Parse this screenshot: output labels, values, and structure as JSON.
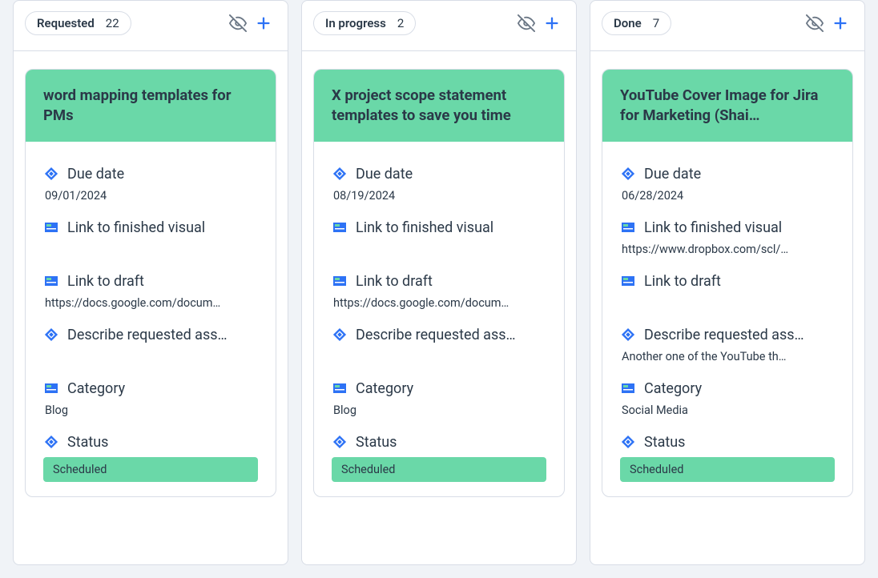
{
  "field_labels": {
    "due_date": "Due date",
    "link_visual": "Link to finished visual",
    "link_draft": "Link to draft",
    "describe": "Describe requested ass…",
    "category": "Category",
    "status": "Status"
  },
  "columns": [
    {
      "name": "Requested",
      "count": "22",
      "card": {
        "title": "word mapping templates for PMs",
        "due_date": "09/01/2024",
        "link_visual": "",
        "link_draft": "https://docs.google.com/docum…",
        "describe": "",
        "category": "Blog",
        "status": "Scheduled"
      }
    },
    {
      "name": "In progress",
      "count": "2",
      "card": {
        "title": "X project scope statement templates to save you time",
        "due_date": "08/19/2024",
        "link_visual": "",
        "link_draft": "https://docs.google.com/docum…",
        "describe": "",
        "category": "Blog",
        "status": "Scheduled"
      }
    },
    {
      "name": "Done",
      "count": "7",
      "card": {
        "title": "YouTube Cover Image for Jira for Marketing (Shai…",
        "due_date": "06/28/2024",
        "link_visual": "https://www.dropbox.com/scl/…",
        "link_draft": "",
        "describe": "Another one of the YouTube th…",
        "category": "Social Media",
        "status": "Scheduled"
      }
    }
  ]
}
